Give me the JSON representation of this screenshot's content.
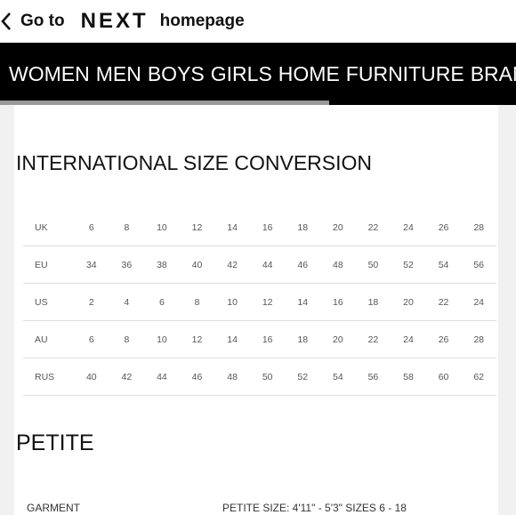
{
  "topbar": {
    "go_to": "Go to",
    "logo": "NEXT",
    "homepage": "homepage"
  },
  "nav": {
    "items": [
      "WOMEN",
      "MEN",
      "BOYS",
      "GIRLS",
      "HOME",
      "FURNITURE",
      "BRANDS"
    ]
  },
  "size_section": {
    "title": "INTERNATIONAL SIZE CONVERSION",
    "rows": [
      {
        "label": "UK",
        "values": [
          "6",
          "8",
          "10",
          "12",
          "14",
          "16",
          "18",
          "20",
          "22",
          "24",
          "26",
          "28"
        ]
      },
      {
        "label": "EU",
        "values": [
          "34",
          "36",
          "38",
          "40",
          "42",
          "44",
          "46",
          "48",
          "50",
          "52",
          "54",
          "56"
        ]
      },
      {
        "label": "US",
        "values": [
          "2",
          "4",
          "6",
          "8",
          "10",
          "12",
          "14",
          "16",
          "18",
          "20",
          "22",
          "24"
        ]
      },
      {
        "label": "AU",
        "values": [
          "6",
          "8",
          "10",
          "12",
          "14",
          "16",
          "18",
          "20",
          "22",
          "24",
          "26",
          "28"
        ]
      },
      {
        "label": "RUS",
        "values": [
          "40",
          "42",
          "44",
          "46",
          "48",
          "50",
          "52",
          "54",
          "56",
          "58",
          "60",
          "62"
        ]
      }
    ]
  },
  "petite": {
    "title": "PETITE",
    "garment_label": "GARMENT",
    "size_label": "PETITE SIZE: 4'11\" - 5'3\" SIZES 6 - 18"
  }
}
